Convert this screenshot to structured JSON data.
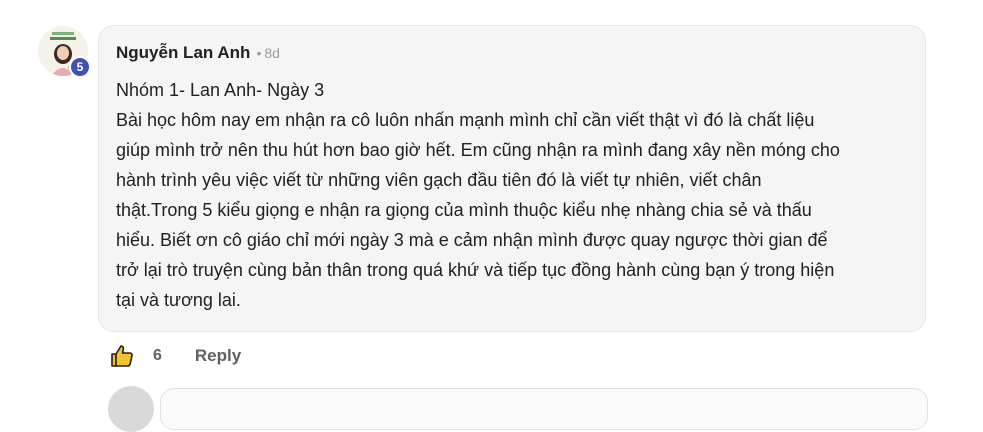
{
  "comment": {
    "author": "Nguyễn Lan Anh",
    "separator": "•",
    "time_ago": "8d",
    "level_badge": "5",
    "avatar_icon": "profile-photo",
    "lines": [
      "Nhóm 1- Lan Anh- Ngày 3",
      "Bài học hôm nay em nhận ra cô luôn nhấn mạnh mình chỉ cần viết thật vì đó là chất liệu",
      "giúp mình trở nên thu hút hơn bao giờ hết. Em cũng nhận ra mình đang xây nền móng cho",
      "hành trình yêu việc viết từ những viên gạch đầu tiên đó là viết tự nhiên, viết chân",
      "thật.Trong 5 kiểu giọng e nhận ra giọng của mình thuộc kiểu nhẹ nhàng chia sẻ và thấu",
      "hiểu. Biết ơn cô giáo chỉ mới ngày 3 mà e cảm nhận mình được quay ngược thời gian để",
      "trở lại trò truyện cùng bản thân trong quá khứ và tiếp tục đồng hành cùng bạn ý trong hiện",
      "tại và tương lai."
    ]
  },
  "actions": {
    "like_icon": "thumbs-up-icon",
    "like_count": "6",
    "reply_label": "Reply"
  },
  "colors": {
    "bubble_bg": "#f5f5f5",
    "badge": "#3f51b5",
    "muted_text": "#616161"
  }
}
